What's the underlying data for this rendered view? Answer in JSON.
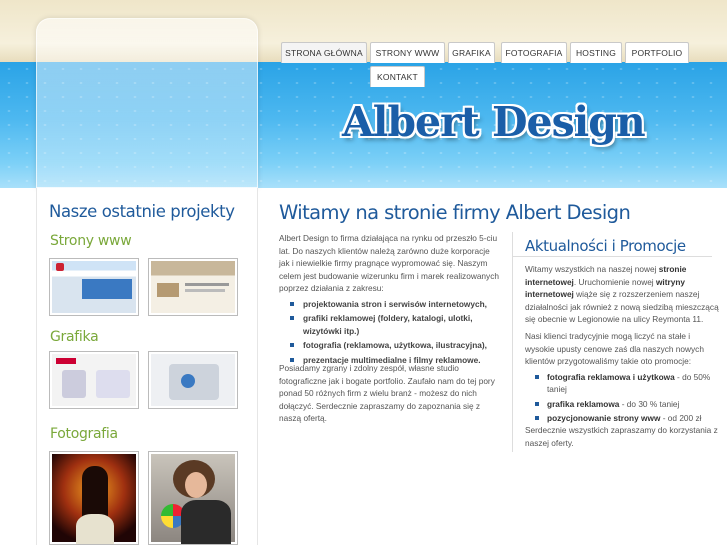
{
  "site": {
    "logo_text": "Albert Design"
  },
  "nav": {
    "tabs": [
      "STRONA GŁÓWNA",
      "STRONY WWW",
      "GRAFIKA",
      "FOTOGRAFIA",
      "HOSTING",
      "PORTFOLIO",
      "KONTAKT"
    ],
    "active": "STRONA GŁÓWNA"
  },
  "left": {
    "title": "Nasze ostatnie projekty",
    "sections": [
      "Strony www",
      "Grafika",
      "Fotografia"
    ]
  },
  "main": {
    "title": "Witamy na stronie firmy Albert Design",
    "intro": "Albert Design to firma działająca na rynku od przeszło 5-ciu lat. Do naszych klientów należą zarówno duże korporacje jak i niewielkie firmy pragnące wypromować się. Naszym celem jest budowanie wizerunku firm i marek realizowanych poprzez działania z zakresu:",
    "bullets": [
      "projektowania stron i serwisów internetowych,",
      "grafiki reklamowej (foldery, katalogi, ulotki, wizytówki itp.)",
      "fotografia (reklamowa, użytkowa, ilustracyjna),",
      "prezentacje multimedialne i filmy reklamowe."
    ],
    "outro": "Posiadamy zgrany i zdolny zespół, własne studio fotograficzne jak i bogate portfolio. Zaufało nam do tej pory ponad 50 różnych firm z wielu branż - możesz do nich dołączyć. Serdecznie zapraszamy do zapoznania się z naszą ofertą."
  },
  "news": {
    "title": "Aktualności i Promocje",
    "p1_a": "Witamy wszystkich na naszej nowej ",
    "p1_b": "stronie internetowej",
    "p1_c": ". Uruchomienie nowej ",
    "p1_d": "witryny internetowej",
    "p1_e": " wiąże się z rozszerzeniem naszej działalności jak również z nową siedzibą mieszczącą się obecnie w Legionowie na ulicy Reymonta 11.",
    "p2": "Nasi klienci tradycyjnie mogą liczyć na stałe i wysokie upusty cenowe zaś dla naszych nowych klientów przygotowaliśmy takie oto promocje:",
    "promos": [
      {
        "b": "fotografia reklamowa i użytkowa",
        "t": " - do 50% taniej"
      },
      {
        "b": "grafika reklamowa",
        "t": " - do 30 % taniej"
      },
      {
        "b": "pozycjonowanie strony www",
        "t": " - od 200 zł"
      }
    ],
    "p3": "Serdecznie wszystkich zapraszamy do korzystania z naszej oferty."
  }
}
